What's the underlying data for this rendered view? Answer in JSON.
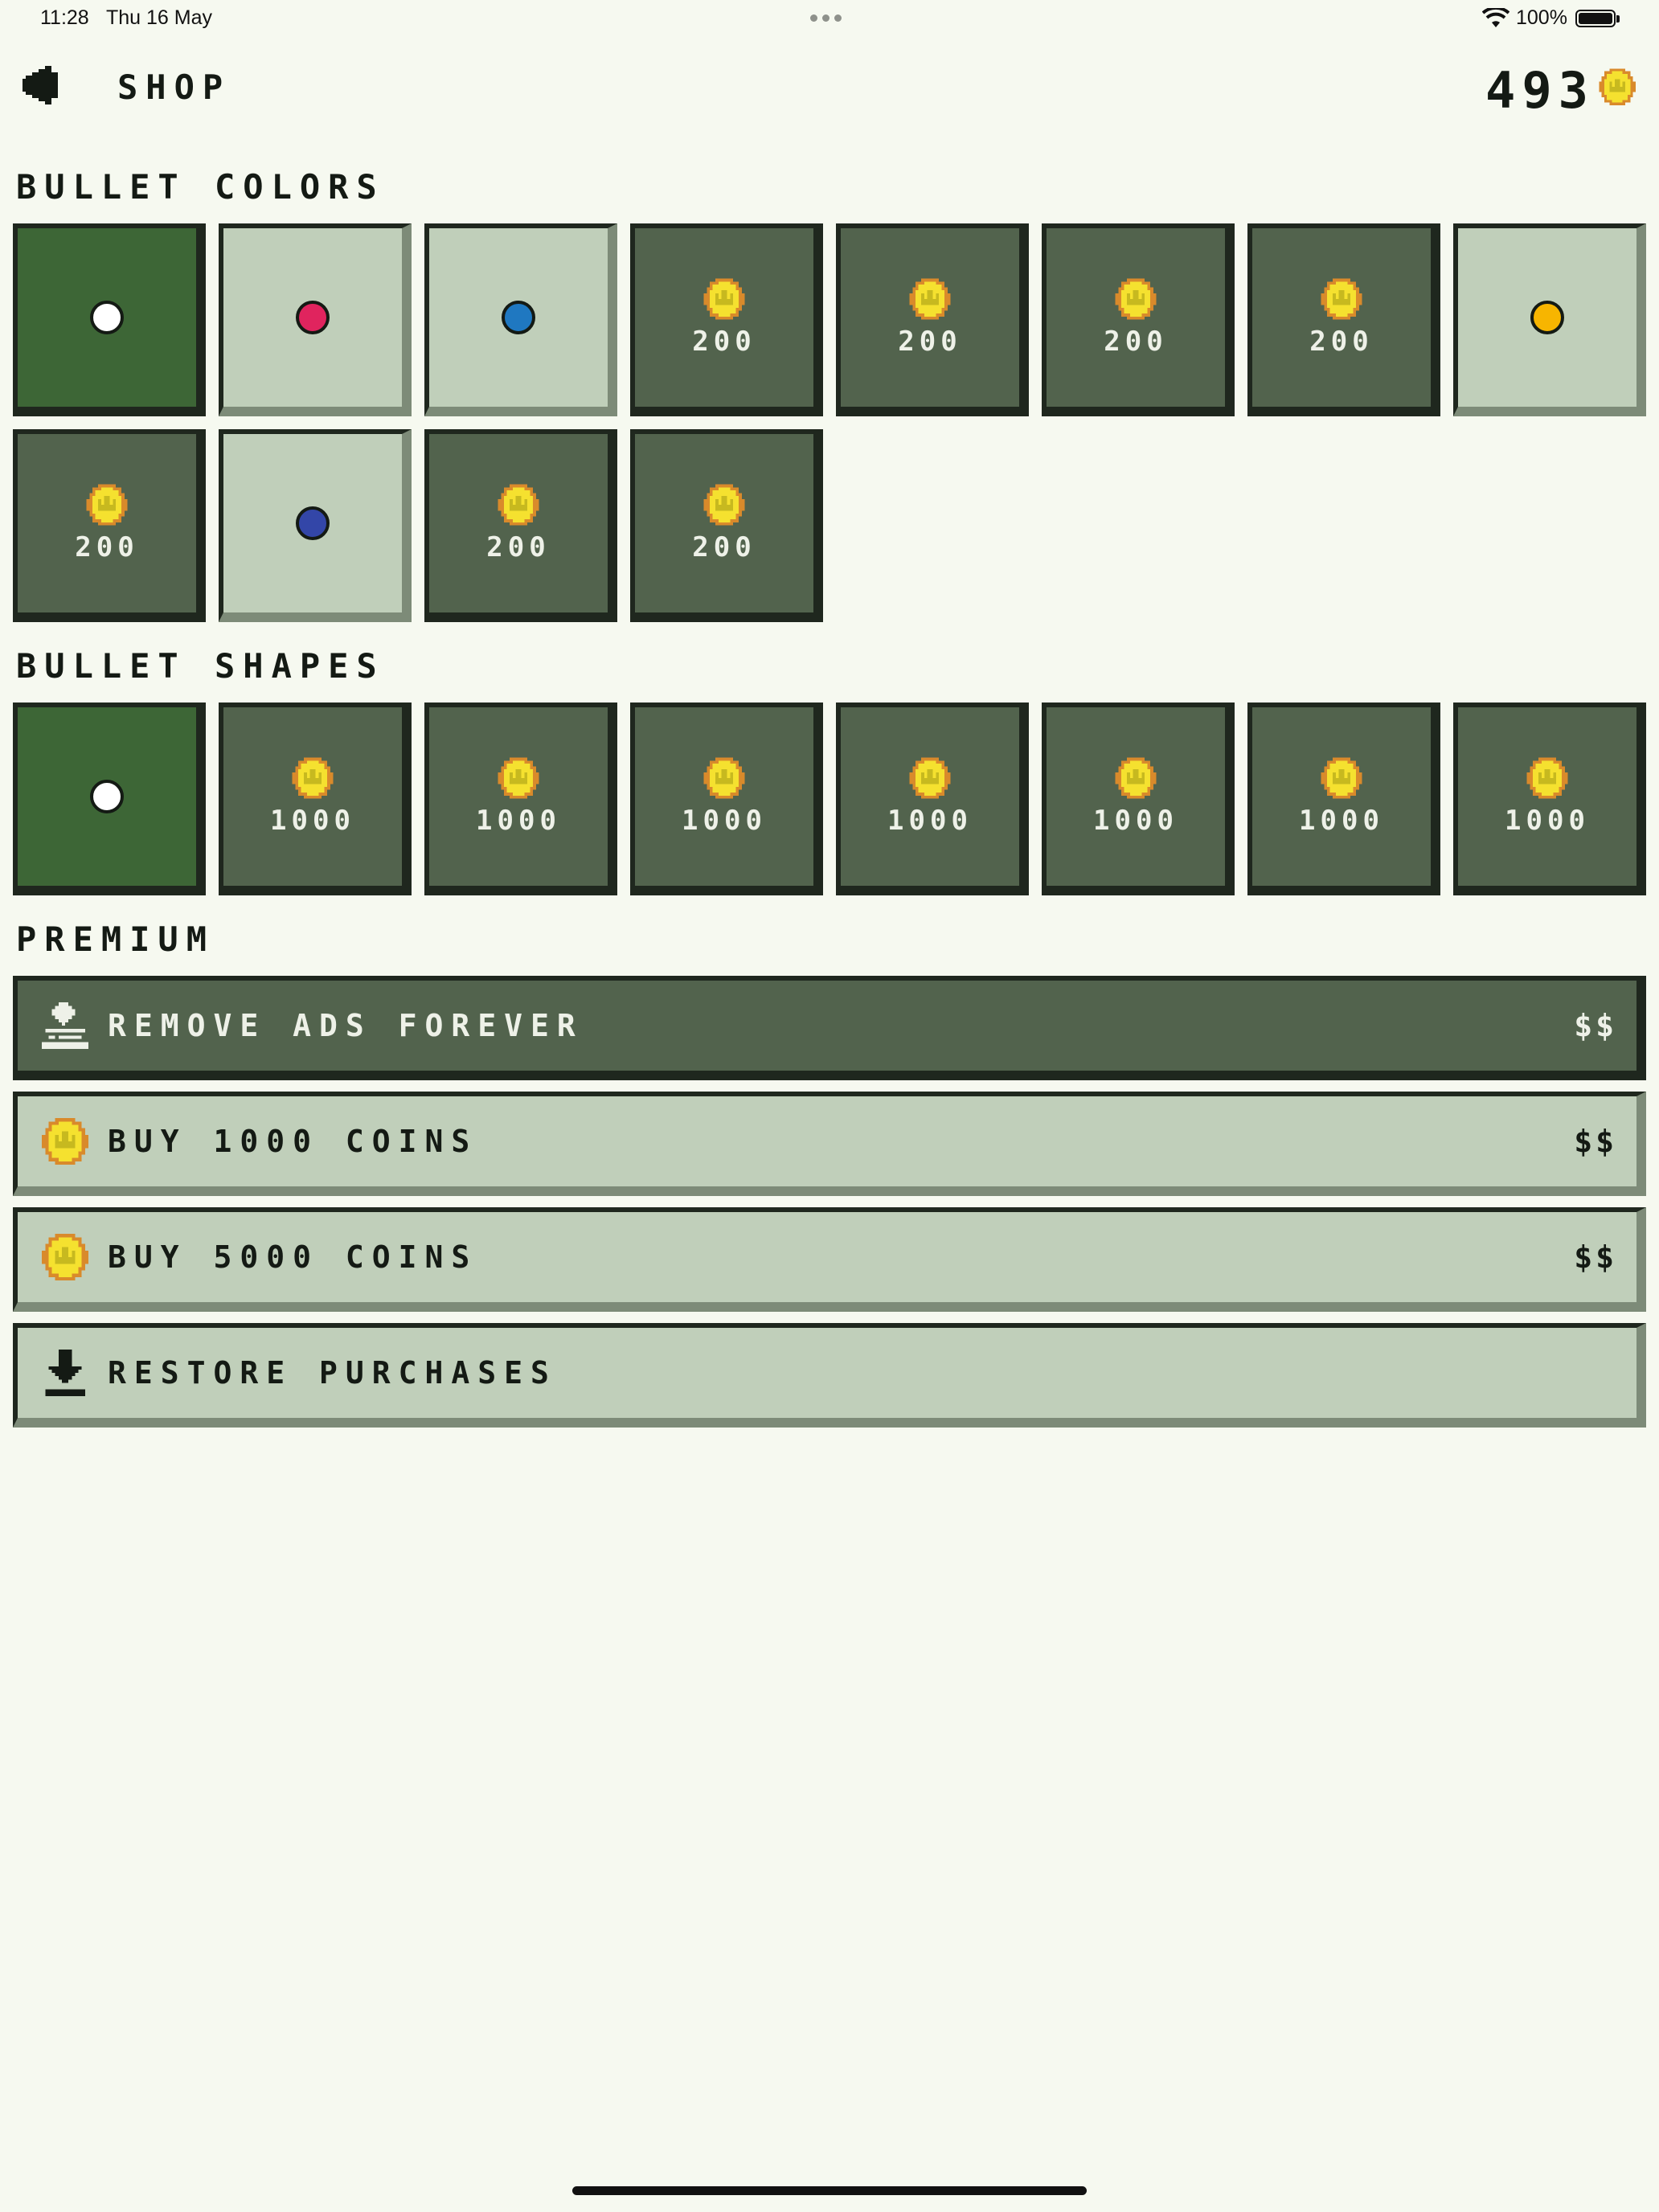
{
  "status_bar": {
    "time": "11:28",
    "date": "Thu 16 May",
    "battery": "100%"
  },
  "header": {
    "title": "SHOP",
    "coins": "493"
  },
  "colors": {
    "tile_selected": "#3d6636",
    "tile_locked": "#52634d",
    "tile_owned": "#c0cfba",
    "coin": "#f5e12f"
  },
  "bullet_colors": {
    "heading": "BULLET COLORS",
    "items": [
      {
        "state": "selected",
        "dot_color": "#ffffff"
      },
      {
        "state": "owned",
        "dot_color": "#e0245e"
      },
      {
        "state": "owned",
        "dot_color": "#1f78c1"
      },
      {
        "state": "locked",
        "price": "200"
      },
      {
        "state": "locked",
        "price": "200"
      },
      {
        "state": "locked",
        "price": "200"
      },
      {
        "state": "locked",
        "price": "200"
      },
      {
        "state": "owned",
        "dot_color": "#f7b500"
      },
      {
        "state": "locked",
        "price": "200"
      },
      {
        "state": "owned",
        "dot_color": "#3346a8"
      },
      {
        "state": "locked",
        "price": "200"
      },
      {
        "state": "locked",
        "price": "200"
      }
    ]
  },
  "bullet_shapes": {
    "heading": "BULLET SHAPES",
    "items": [
      {
        "state": "selected",
        "dot_color": "#ffffff"
      },
      {
        "state": "locked",
        "price": "1000"
      },
      {
        "state": "locked",
        "price": "1000"
      },
      {
        "state": "locked",
        "price": "1000"
      },
      {
        "state": "locked",
        "price": "1000"
      },
      {
        "state": "locked",
        "price": "1000"
      },
      {
        "state": "locked",
        "price": "1000"
      },
      {
        "state": "locked",
        "price": "1000"
      }
    ]
  },
  "premium": {
    "heading": "PREMIUM",
    "items": [
      {
        "label": "REMOVE ADS FOREVER",
        "price": "$$",
        "icon": "no-ads-icon",
        "style": "dark"
      },
      {
        "label": "BUY 1000 COINS",
        "price": "$$",
        "icon": "coin-icon",
        "style": "light"
      },
      {
        "label": "BUY 5000 COINS",
        "price": "$$",
        "icon": "coin-icon",
        "style": "light"
      },
      {
        "label": "RESTORE PURCHASES",
        "price": "",
        "icon": "download-icon",
        "style": "light"
      }
    ]
  }
}
